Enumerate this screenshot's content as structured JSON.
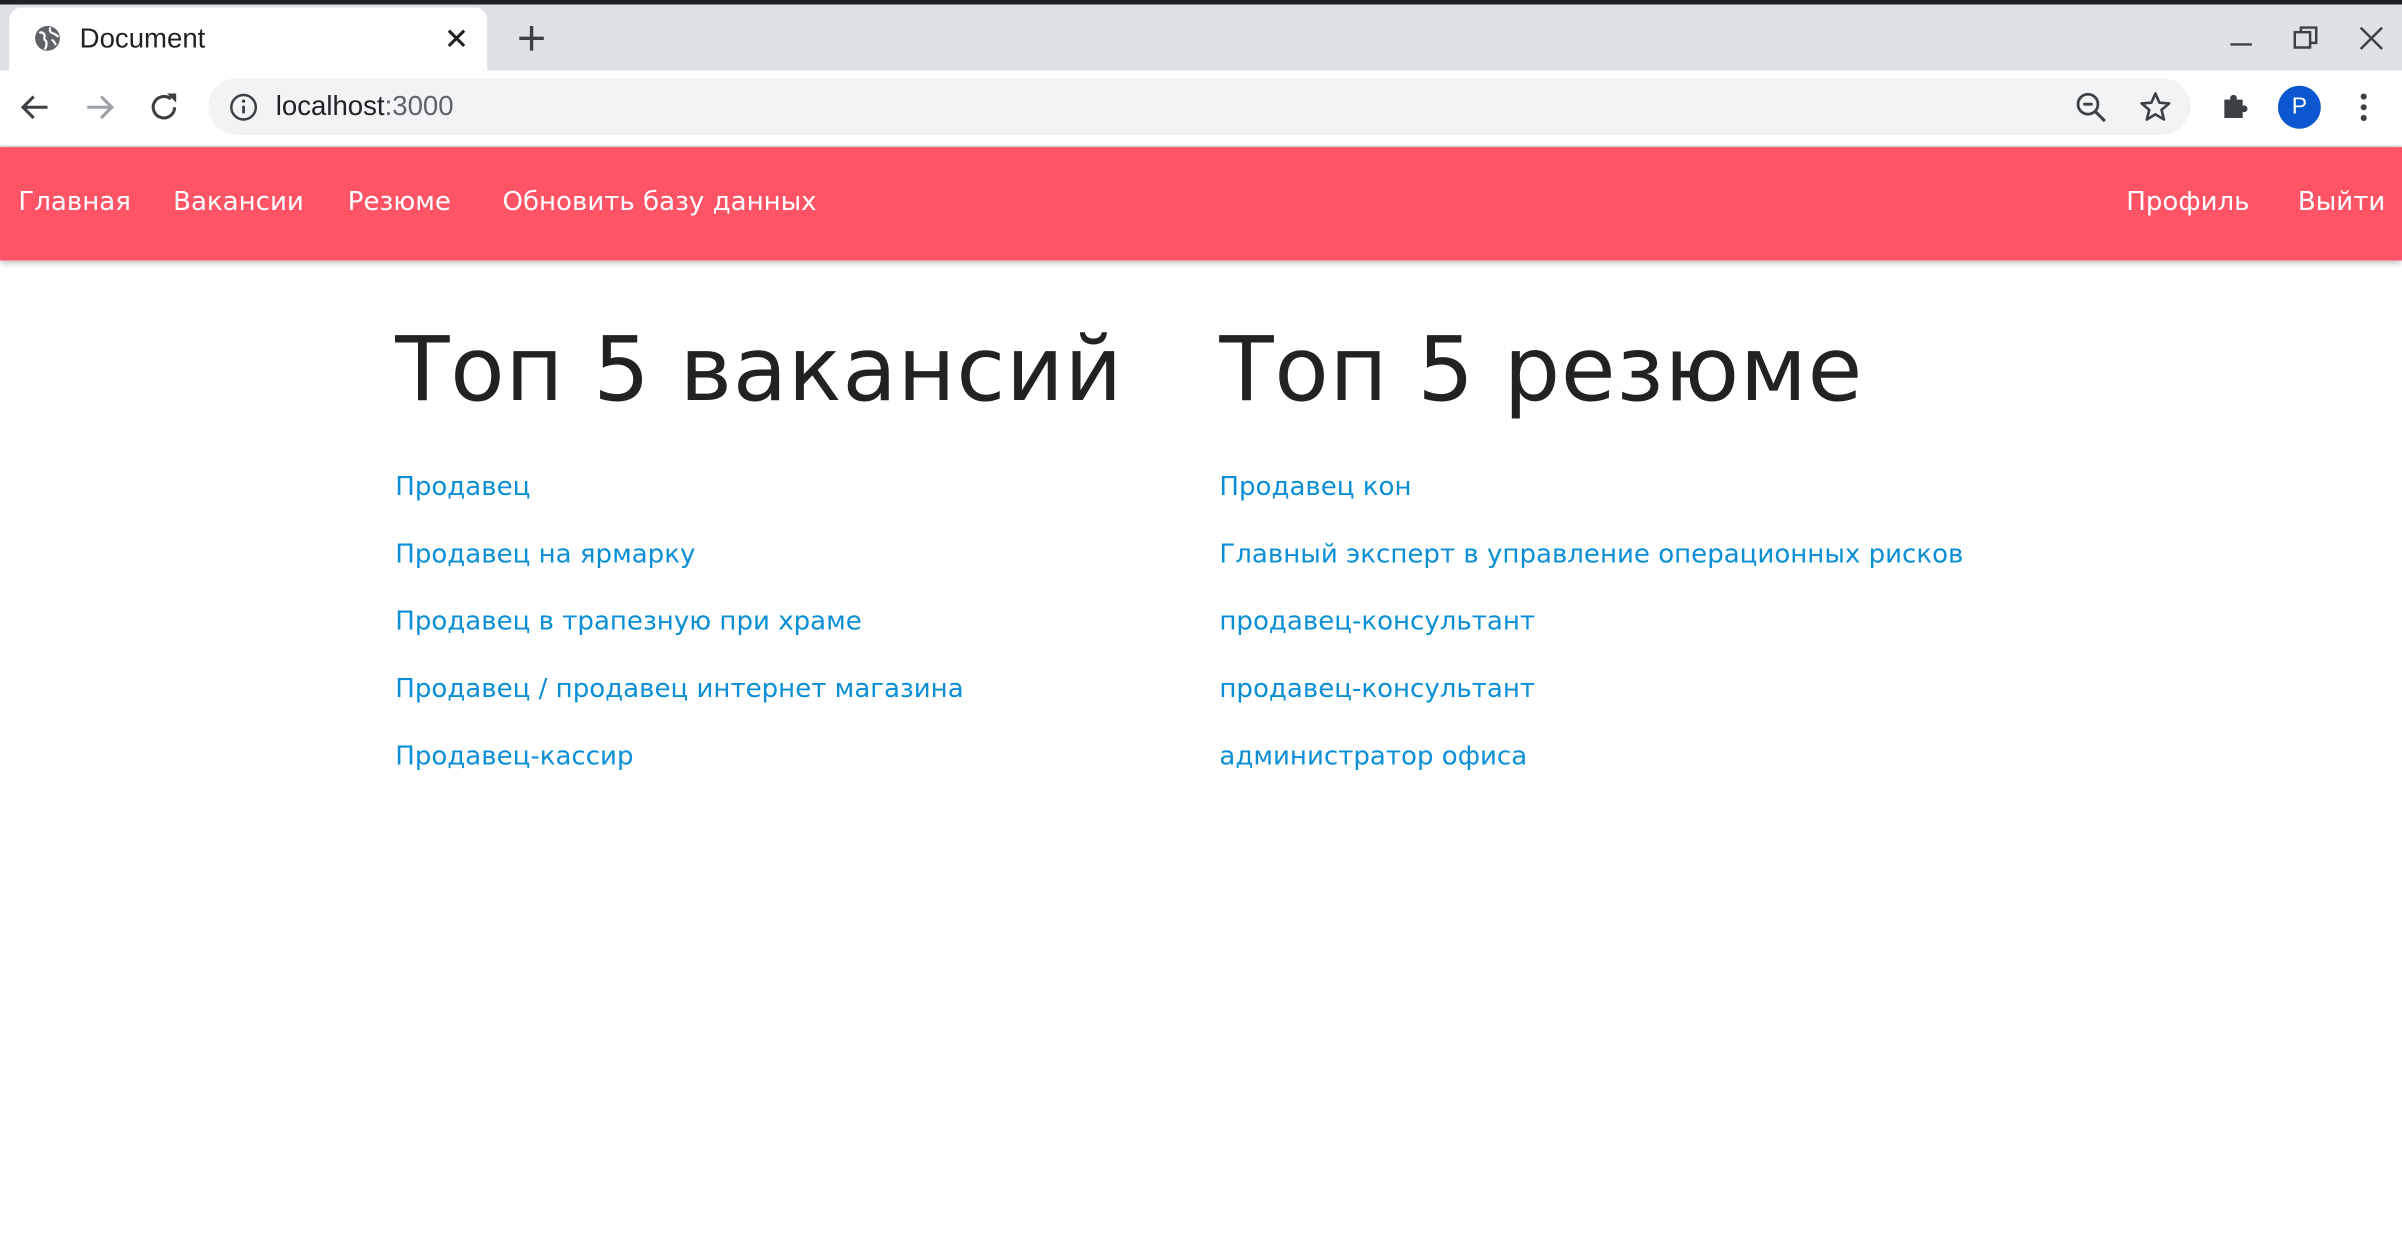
{
  "browser": {
    "tab_title": "Document",
    "url_host": "localhost",
    "url_port": ":3000",
    "profile_initial": "P",
    "icons": [
      "globe-icon",
      "close-icon",
      "plus-icon",
      "minimize-icon",
      "restore-icon",
      "window-close-icon",
      "back-icon",
      "forward-icon",
      "reload-icon",
      "info-icon",
      "zoom-out-icon",
      "star-icon",
      "puzzle-icon",
      "more-vert-icon"
    ]
  },
  "navbar": {
    "color": "#ff5466",
    "left": [
      "Главная",
      "Вакансии",
      "Резюме",
      "Обновить базу данных"
    ],
    "right": [
      "Профиль",
      "Выйти"
    ]
  },
  "vacancies": {
    "title": "Топ 5 вакансий",
    "items": [
      "Продавец",
      "Продавец на ярмарку",
      "Продавец в трапезную при храме",
      "Продавец / продавец интернет магазина",
      "Продавец-кассир"
    ]
  },
  "resumes": {
    "title": "Топ 5 резюме",
    "items": [
      "Продавец кон",
      "Главный эксперт в управление операционных рисков",
      "продавец-консультант",
      "продавец-консультант",
      "администратор офиса"
    ]
  },
  "colors": {
    "link": "#0a8fd6",
    "heading": "#222222"
  }
}
